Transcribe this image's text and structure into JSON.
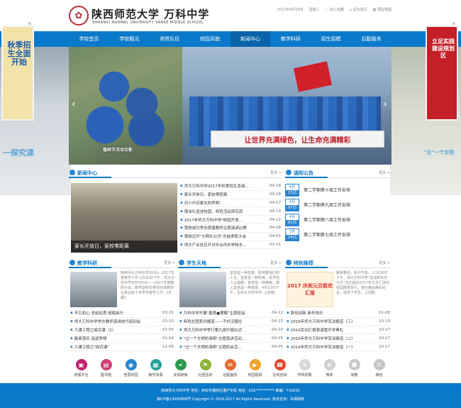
{
  "header": {
    "school_cn": "陕西师范大学 万科中学",
    "school_en": "SHAANXI NORMAL UNIVERSITY VANKE MIDDLE SCHOOL",
    "date": "2017年4月18日",
    "weekday": "星期二",
    "favorite": "加入收藏",
    "homepage": "设为首页",
    "sitemap": "网站地图"
  },
  "nav": [
    "学校首页",
    "学校概况",
    "师资队伍",
    "校园风貌",
    "新闻中心",
    "教学科研",
    "招生招聘",
    "后勤服务"
  ],
  "banner": {
    "caption": "植树节活动合影",
    "slogan": "让世界充满绿色，让生命充满精彩"
  },
  "bg": {
    "left": "一探究课",
    "right": "\"日\"一个文明"
  },
  "ads": {
    "left": "秋季招生全面开始",
    "right": "立足实践 建设规划区",
    "close": "×"
  },
  "news": {
    "title": "新闻中心",
    "more": "更多 >",
    "img_caption": "家长开放日，家校零距离",
    "items": [
      {
        "t": "师大万科中学2017年秋季招生咨询...",
        "d": "04-18"
      },
      {
        "t": "家长开放日，家校零距离",
        "d": "04-18"
      },
      {
        "t": "对小升初家长的声明：",
        "d": "04-17"
      },
      {
        "t": "煤沫礼堂进校园，特色活动添花蕊",
        "d": "04-13"
      },
      {
        "t": "2017年师大万科中学\"校园开放...",
        "d": "04-12"
      },
      {
        "t": "我校成功举办首届教师主题演讲比赛",
        "d": "04-08"
      },
      {
        "t": "我校召开\"文明礼仪月\"总结表彰大会",
        "d": "04-01"
      },
      {
        "t": "师大产业处召开对外合作办学校长...",
        "d": "03-31"
      }
    ]
  },
  "notice": {
    "title": "通知公告",
    "more": "更多 >",
    "items": [
      {
        "m": "4月",
        "d": "15日",
        "t": "第二学期第十周工作安排"
      },
      {
        "m": "4月",
        "d": "07日",
        "t": "第二学期第九周工作安排"
      },
      {
        "m": "4月",
        "d": "01日",
        "t": "第二学期第八周工作安排"
      },
      {
        "m": "3月",
        "d": "24日",
        "t": "第二学期第七周工作安排"
      }
    ]
  },
  "teaching": {
    "title": "教学科研",
    "more": "更多 >",
    "snippet": "陕西师大万科中学2016—2017年度教学工作 1月30日下午，师大万科中学召开2016——2017年度教研大会。教学副校长带领全体教师认真总结了本学年教学工作...[详细]",
    "items": [
      {
        "t": "不忘初心 总结反思 砥砺前行",
        "d": "03-31"
      },
      {
        "t": "师大万科中学举办教师演讲技巧培训会",
        "d": "03-10"
      },
      {
        "t": "六课工程之探究课（2）",
        "d": "01-05"
      },
      {
        "t": "勤奋落实 追逐梦想",
        "d": "01-04"
      },
      {
        "t": "六课工程之\"探究课\"",
        "d": "12-09"
      }
    ]
  },
  "students": {
    "title": "学生天地",
    "more": "更多 >",
    "snippet": "善意是一种态度，影响着我们的人生。善意是一种赞美，给予他人以温暖；善意是一种奉献，融入善意是一种尊重，4月10日下午，在师大万科中学...[详细]",
    "items": [
      {
        "t": "万科中学开展\"善意●理解\"主题班会",
        "d": "04-12"
      },
      {
        "t": "特色社团系列报道——子衿汉服社",
        "d": "04-10"
      },
      {
        "t": "师大万科中学举行第九周升旗仪式",
        "d": "04-10"
      },
      {
        "t": "\"过一个文明的清明\"主题演讲活动...",
        "d": "04-05"
      },
      {
        "t": "\"过一个文明的清明\"主题班会活...",
        "d": "04-05"
      }
    ]
  },
  "special": {
    "title": "特别推荐",
    "more": "更多 >",
    "poster": "2017 庆祝元旦联欢汇报",
    "snippet": "雅致春风，新元气象。11月30日下午，师大万科中学\"喜迎新年庆元旦\"为主题的2017年元旦汇演在校园隆重举行。整台晚会精彩纷呈，体现了学生... [详细]",
    "items": [
      {
        "t": "辞旧迎新 新年快乐",
        "d": "01-08"
      },
      {
        "t": "2016年师大万科中学军训报道（三）",
        "d": "10-19"
      },
      {
        "t": "2016军训汇报表演暨开学典礼",
        "d": "10-17"
      },
      {
        "t": "2016年师大万科中学军训报道（二）",
        "d": "10-17"
      },
      {
        "t": "2016年师大万科中学军训报道（一）",
        "d": "10-17"
      }
    ]
  },
  "icons": [
    {
      "l": "管理平台",
      "c": "#c21f6f",
      "g": "▣",
      "n": "management-icon"
    },
    {
      "l": "图书馆",
      "c": "#d13f78",
      "g": "▤",
      "n": "library-icon"
    },
    {
      "l": "智慧校园",
      "c": "#2a86d0",
      "g": "◉",
      "n": "smart-campus-icon"
    },
    {
      "l": "教学资源",
      "c": "#27a39a",
      "g": "▦",
      "n": "resource-icon"
    },
    {
      "l": "友情链接",
      "c": "#2e9a4f",
      "g": "⚭",
      "n": "link-icon"
    },
    {
      "l": "社团活动",
      "c": "#8bb536",
      "g": "⚑",
      "n": "club-icon"
    },
    {
      "l": "远程面授",
      "c": "#e56b30",
      "g": "✉",
      "n": "remote-icon"
    },
    {
      "l": "校园视频",
      "c": "#f0a32a",
      "g": "▶",
      "n": "video-icon"
    },
    {
      "l": "在线咨询",
      "c": "#e8442c",
      "g": "☎",
      "n": "consult-icon"
    },
    {
      "l": "学校招聘",
      "c": "#d8d8d8",
      "g": "✎",
      "n": "recruit-icon"
    },
    {
      "l": "微单",
      "c": "#cfcfcf",
      "g": "✿",
      "n": "weidan-icon"
    },
    {
      "l": "家教",
      "c": "#c8c8c8",
      "g": "☻",
      "n": "tutor-icon"
    },
    {
      "l": "微信",
      "c": "#c4c4c4",
      "g": "✆",
      "n": "wechat-icon"
    }
  ],
  "footer": {
    "line1": "陕西师大万科中学   地址：西安市灞桥区灞浐中段   电话：029-**********   邮编：710016",
    "line2": "陕ICP备13000808号 Copyright © 2016-2017   All Rights Reserved. 技术支持：百相网络"
  },
  "colors": {
    "brand": "#0b79c9",
    "accent": "#2a86d0"
  }
}
